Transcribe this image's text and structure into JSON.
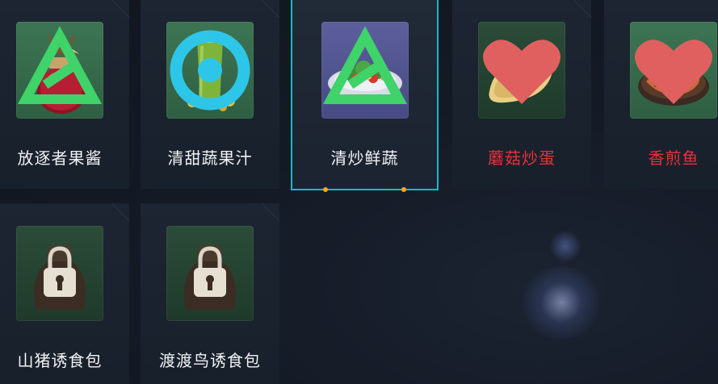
{
  "items": [
    {
      "name": "放逐者果酱",
      "badge": "triangle-icon",
      "locked": false
    },
    {
      "name": "清甜蔬果汁",
      "badge": "ring-icon",
      "locked": false
    },
    {
      "name": "清炒鲜蔬",
      "badge": "triangle-icon",
      "locked": false,
      "selected": true
    },
    {
      "name": "蘑菇炒蛋",
      "badge": "heart-icon",
      "locked": false,
      "highlight": "red"
    },
    {
      "name": "香煎鱼",
      "badge": "heart-icon",
      "locked": false,
      "highlight": "red"
    },
    {
      "name": "山猪诱食包",
      "locked": true
    },
    {
      "name": "渡渡鸟诱食包",
      "locked": true
    }
  ],
  "colors": {
    "selected_border": "#19b8c8",
    "red_label": "#e8313a",
    "badge_green": "#3fd36a",
    "badge_cyan": "#2ec6e8",
    "badge_heart": "#e06060"
  }
}
